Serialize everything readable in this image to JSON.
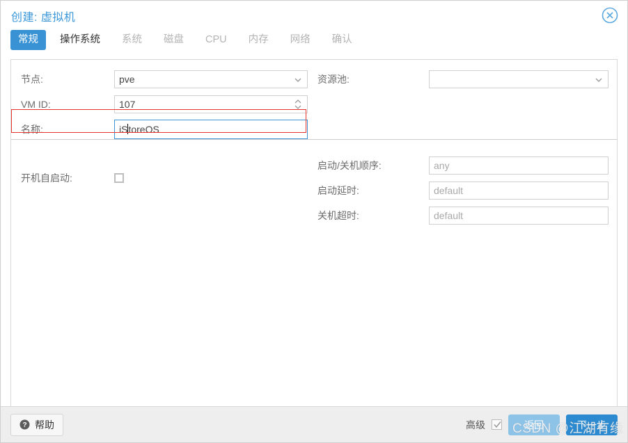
{
  "dialog": {
    "title": "创建: 虚拟机",
    "close_icon": "close-circle-icon"
  },
  "tabs": [
    {
      "label": "常规",
      "state": "active"
    },
    {
      "label": "操作系统",
      "state": "enabled"
    },
    {
      "label": "系统",
      "state": "disabled"
    },
    {
      "label": "磁盘",
      "state": "disabled"
    },
    {
      "label": "CPU",
      "state": "disabled"
    },
    {
      "label": "内存",
      "state": "disabled"
    },
    {
      "label": "网络",
      "state": "disabled"
    },
    {
      "label": "确认",
      "state": "disabled"
    }
  ],
  "general": {
    "node": {
      "label": "节点:",
      "value": "pve",
      "icon": "chevron-down-icon"
    },
    "vmid": {
      "label": "VM ID:",
      "value": "107",
      "icon": "spinner-updown-icon"
    },
    "name": {
      "label": "名称:",
      "value_before_cursor": "iS",
      "value_after_cursor": "toreOS",
      "value": "iStoreOS",
      "focused": true,
      "highlighted": true
    },
    "pool": {
      "label": "资源池:",
      "value": "",
      "icon": "chevron-down-icon"
    }
  },
  "advanced_section": {
    "start_at_boot": {
      "label": "开机自启动:",
      "checked": false
    },
    "start_order": {
      "label": "启动/关机顺序:",
      "placeholder": "any",
      "value": ""
    },
    "startup_delay": {
      "label": "启动延时:",
      "placeholder": "default",
      "value": ""
    },
    "shutdown_timeout": {
      "label": "关机超时:",
      "placeholder": "default",
      "value": ""
    }
  },
  "footer": {
    "help_label": "帮助",
    "help_icon": "question-circle-icon",
    "advanced_label": "高级",
    "advanced_checked": true,
    "back_label": "返回",
    "next_label": "下一步"
  },
  "watermark": {
    "text": "CSDN @江湖有缘"
  },
  "colors": {
    "accent": "#3892d4",
    "title": "#3b97d9",
    "next_button": "#2b8ad0",
    "back_button": "#8ec3e8",
    "annotation": "#e8342a",
    "footer_bg": "#eeeeee"
  }
}
